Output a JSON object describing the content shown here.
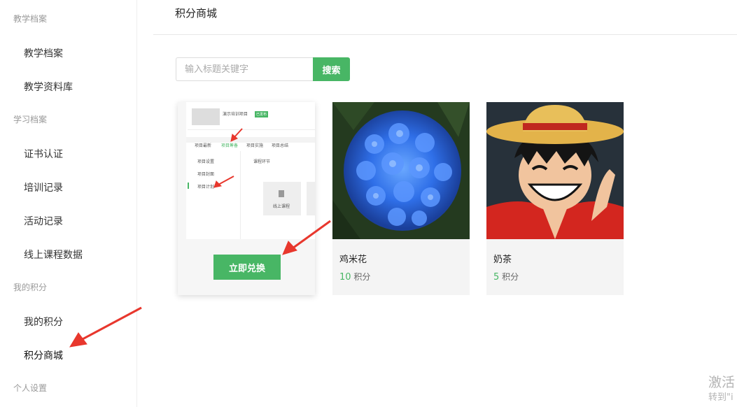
{
  "sidebar": {
    "groups": [
      {
        "title": "教学档案",
        "items": [
          "教学档案",
          "教学资料库"
        ]
      },
      {
        "title": "学习档案",
        "items": [
          "证书认证",
          "培训记录",
          "活动记录",
          "线上课程数据"
        ]
      },
      {
        "title": "我的积分",
        "items": [
          "我的积分",
          "积分商城"
        ]
      },
      {
        "title": "个人设置",
        "items": []
      }
    ],
    "active": "积分商城"
  },
  "header": {
    "title": "积分商城"
  },
  "search": {
    "placeholder": "输入标题关键字",
    "button_label": "搜索"
  },
  "products": [
    {
      "type": "featured",
      "redeem_label": "立即兑换",
      "preview": {
        "project_name": "演示培训项目",
        "status_badge": "已发布",
        "tabs": [
          "项目最新",
          "项目筹备",
          "项目实施",
          "项目总结"
        ],
        "side_items": [
          "项目设置",
          "项目封面",
          "项目计划"
        ],
        "section_title": "课程环节",
        "course_label": "线上课程"
      }
    },
    {
      "name": "鸡米花",
      "points": "10",
      "unit": "积分",
      "image": "blue-hydrangea"
    },
    {
      "name": "奶茶",
      "points": "5",
      "unit": "积分",
      "image": "cartoon-straw-hat-boy"
    }
  ],
  "watermark": {
    "line1": "激活",
    "line2": "转到\"i"
  },
  "colors": {
    "accent": "#48b665",
    "annotation": "#e8372d"
  }
}
